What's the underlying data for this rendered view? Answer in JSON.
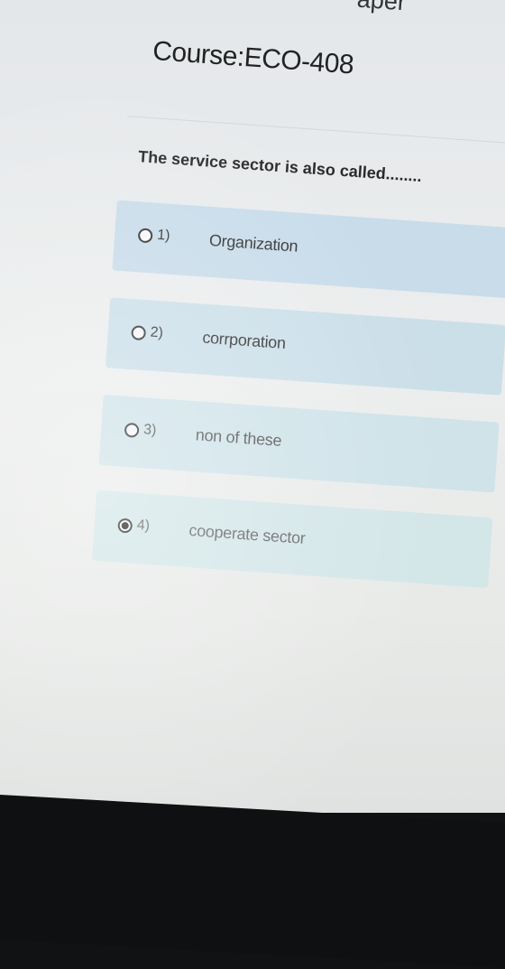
{
  "page": {
    "heading_partial": "aper",
    "course_title": "Course:ECO-408"
  },
  "question": {
    "text": "The service sector is also called........"
  },
  "options": [
    {
      "number": "1)",
      "text": "Organization",
      "selected": false
    },
    {
      "number": "2)",
      "text": "corrporation",
      "selected": false
    },
    {
      "number": "3)",
      "text": "non of these",
      "selected": false
    },
    {
      "number": "4)",
      "text": "cooperate sector",
      "selected": true
    }
  ],
  "colors": {
    "option_background": "#cfe2ee",
    "text": "#333333",
    "bezel": "#0e1012"
  }
}
